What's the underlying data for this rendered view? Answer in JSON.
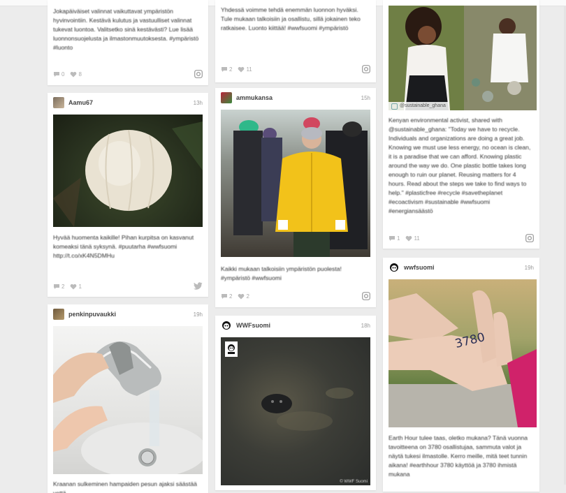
{
  "cards": {
    "c1": {
      "text": "Jokapäiväiset valinnat vaikuttavat ympäristön hyvinvointiin. Kestävä kulutus ja vastuulliset valinnat tukevat luontoa. Valitsetko sinä kestävästi? Lue lisää luonnonsuojelusta ja ilmastonmuutoksesta. #ympäristö #luonto",
      "comments": "0",
      "likes": "8",
      "source_icon": "instagram-icon"
    },
    "c2": {
      "text": "Yhdessä voimme tehdä enemmän luonnon hyväksi. Tule mukaan talkoisiin ja osallistu, sillä jokainen teko ratkaisee. Luonto kiittää! #wwfsuomi #ympäristö",
      "comments": "2",
      "likes": "11",
      "source_icon": "instagram-icon"
    },
    "c3": {
      "image_label": "@sustainable_ghana",
      "text": "Kenyan environmental activist, shared with @sustainable_ghana: \"Today we have to recycle. Individuals and organizations are doing a great job. Knowing we must use less energy, no ocean is clean, it is a paradise that we can afford. Knowing plastic around the way we do. One plastic bottle takes long enough to ruin our planet. Reusing matters for 4 hours. Read about the steps we take to find ways to help.\" #plasticfree #recycle #savetheplanet #ecoactivism #sustainable #wwfsuomi #energiansäästö",
      "comments": "1",
      "likes": "11",
      "source_icon": "instagram-icon"
    },
    "c4": {
      "user": "Aamu67",
      "age": "13h",
      "text": "Hyvää huomenta kaikille! Pihan kurpitsa on kasvanut komeaksi tänä syksynä. #puutarha #wwfsuomi http://t.co/xK4N5DMHu",
      "comments": "2",
      "likes": "1",
      "source_icon": "twitter-icon"
    },
    "c5": {
      "user": "ammukansa",
      "age": "15h",
      "text": "Kaikki mukaan talkoisiin ympäristön puolesta! #ympäristö #wwfsuomi",
      "comments": "2",
      "likes": "2",
      "source_icon": "instagram-icon"
    },
    "c6": {
      "user": "WWFsuomi",
      "age": "18h",
      "credit": "© WWF Suomi"
    },
    "c7": {
      "user": "penkinpuvaukki",
      "age": "19h",
      "text": "Kraanan sulkeminen hampaiden pesun ajaksi säästää vettä."
    },
    "c8": {
      "user": "wwfsuomi",
      "age": "19h",
      "hand_text": "3780",
      "text": "Earth Hour tulee taas, oletko mukana? Tänä vuonna tavoitteena on 3780 osallistujaa, sammuta valot ja näytä tukesi ilmastolle. Kerro meille, mitä teet tunnin aikana! #earthhour 3780 käyttöä ja 3780 ihmistä mukana"
    }
  },
  "colors": {
    "page_bg": "#ececec",
    "card_bg": "#ffffff",
    "jacket_yellow": "#f2c21a",
    "sleeve_pink": "#d0226a"
  }
}
